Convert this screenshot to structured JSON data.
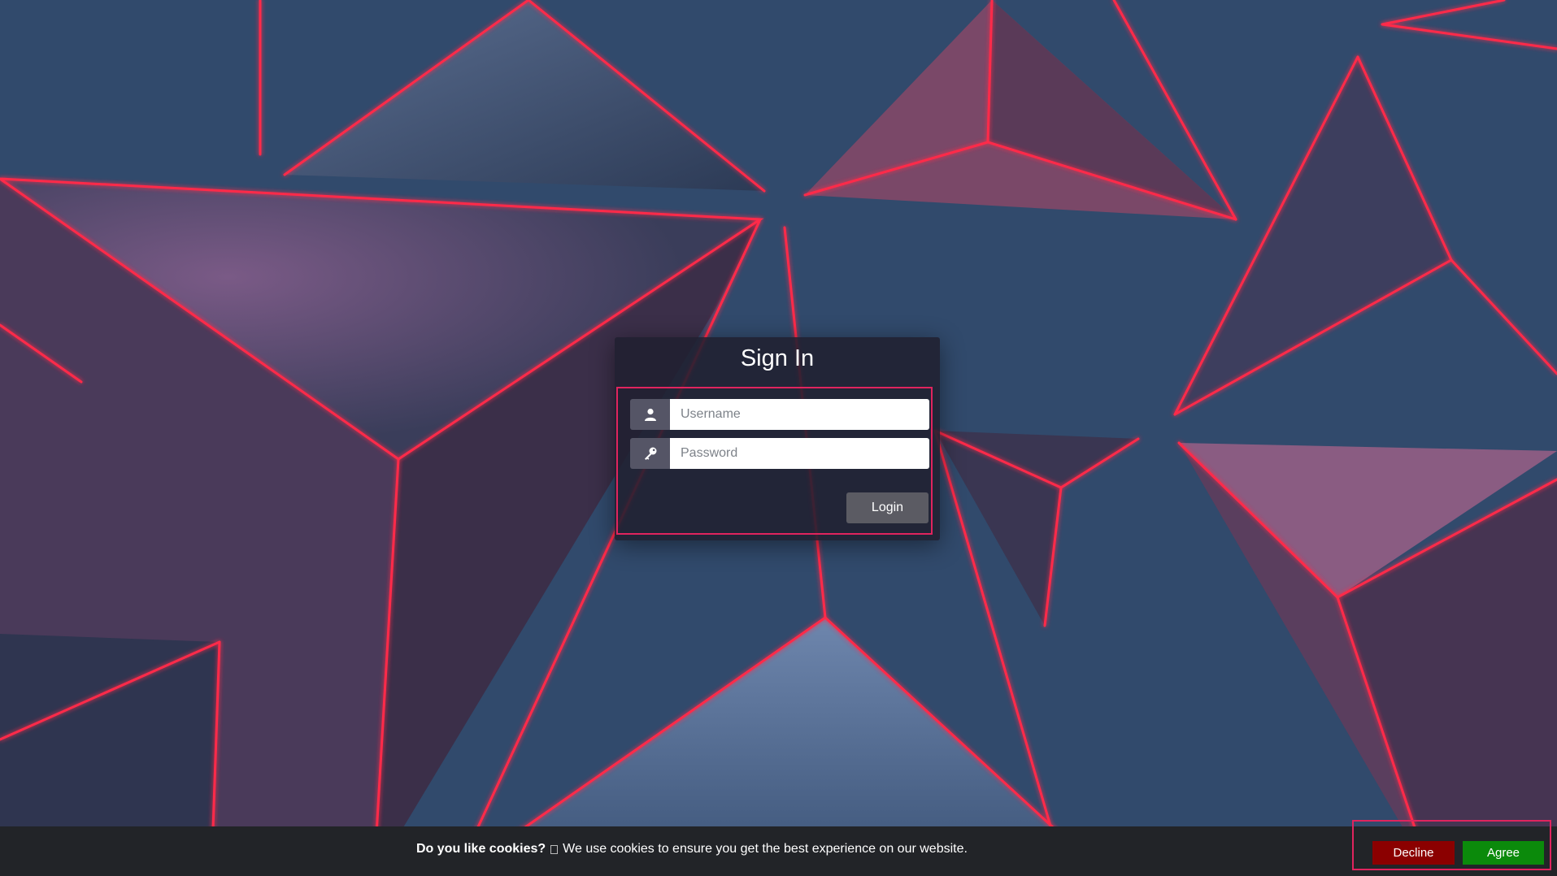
{
  "signin": {
    "title": "Sign In",
    "username_placeholder": "Username",
    "password_placeholder": "Password",
    "login_label": "Login",
    "icons": [
      "user-icon",
      "key-icon"
    ]
  },
  "cookie": {
    "question": "Do you like cookies?",
    "message": "We use cookies to ensure you get the best experience on our website.",
    "decline_label": "Decline",
    "agree_label": "Agree"
  },
  "colors": {
    "accent": "#e0245e",
    "decline": "#8b0000",
    "agree": "#0b8a0b"
  }
}
